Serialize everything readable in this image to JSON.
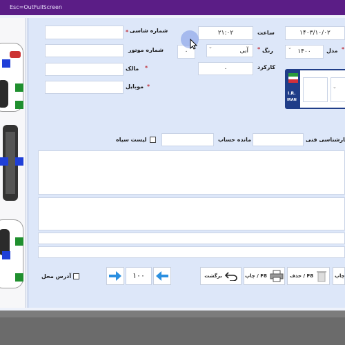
{
  "window": {
    "title": "Esc=OutFullScreen"
  },
  "form": {
    "chassis_label": "شماره شاسی",
    "engine_label": "شماره موتور",
    "owner_label": "مالک",
    "mobile_label": "موبایل",
    "time_label": "ساعت",
    "time_value": "۲۱:۰۲",
    "date_value": "۱۴۰۳/۱۰/۰۲",
    "color_label": "رنگ",
    "color_value": "آبی",
    "small_value": "۰",
    "model_label": "مدل",
    "model_value": "۱۴۰۰",
    "mileage_label": "کارکرد",
    "mileage_value": "۰",
    "plate_ir": "I.R.",
    "plate_iran": "IRAN",
    "blacklist_label": "لیست سیاه",
    "balance_label": "مانده حساب",
    "tech_expert_label": "کارشناسی فنی",
    "address_label": "آدرس محل",
    "required_mark": "*",
    "chevron": "⌄"
  },
  "toolbar": {
    "page_value": "۱۰۰",
    "return_label": "برگشت",
    "print_label": "چاپ / F8",
    "delete_label": "حذف / F8",
    "print_short": "چاپ"
  },
  "colors": {
    "title_bar": "#5b1d86",
    "accent_blue": "#1f3fd8",
    "accent_green": "#1f8f2e"
  }
}
